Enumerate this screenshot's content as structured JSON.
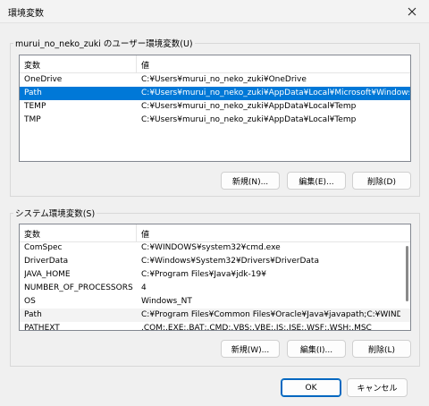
{
  "window": {
    "title": "環境変数"
  },
  "user_vars": {
    "label": "murui_no_neko_zuki のユーザー環境変数(U)",
    "headers": [
      "変数",
      "値"
    ],
    "rows": [
      {
        "name": "OneDrive",
        "value": "C:¥Users¥murui_no_neko_zuki¥OneDrive"
      },
      {
        "name": "Path",
        "value": "C:¥Users¥murui_no_neko_zuki¥AppData¥Local¥Microsoft¥Windows..."
      },
      {
        "name": "TEMP",
        "value": "C:¥Users¥murui_no_neko_zuki¥AppData¥Local¥Temp"
      },
      {
        "name": "TMP",
        "value": "C:¥Users¥murui_no_neko_zuki¥AppData¥Local¥Temp"
      }
    ],
    "buttons": {
      "new": "新規(N)...",
      "edit": "編集(E)...",
      "delete": "削除(D)"
    }
  },
  "system_vars": {
    "label": "システム環境変数(S)",
    "headers": [
      "変数",
      "値"
    ],
    "rows": [
      {
        "name": "ComSpec",
        "value": "C:¥WINDOWS¥system32¥cmd.exe"
      },
      {
        "name": "DriverData",
        "value": "C:¥Windows¥System32¥Drivers¥DriverData"
      },
      {
        "name": "JAVA_HOME",
        "value": "C:¥Program Files¥Java¥jdk-19¥"
      },
      {
        "name": "NUMBER_OF_PROCESSORS",
        "value": "4"
      },
      {
        "name": "OS",
        "value": "Windows_NT"
      },
      {
        "name": "Path",
        "value": "C:¥Program Files¥Common Files¥Oracle¥Java¥javapath;C:¥WINDOW..."
      },
      {
        "name": "PATHEXT",
        "value": ".COM;.EXE;.BAT;.CMD;.VBS;.VBE;.JS;.JSE;.WSF;.WSH;.MSC"
      }
    ],
    "buttons": {
      "new": "新規(W)...",
      "edit": "編集(I)...",
      "delete": "削除(L)"
    }
  },
  "dialog_buttons": {
    "ok": "OK",
    "cancel": "キャンセル"
  },
  "colors": {
    "selection": "#0078d7",
    "primary_border": "#0067c0"
  },
  "icons": {
    "close": "close-icon"
  }
}
